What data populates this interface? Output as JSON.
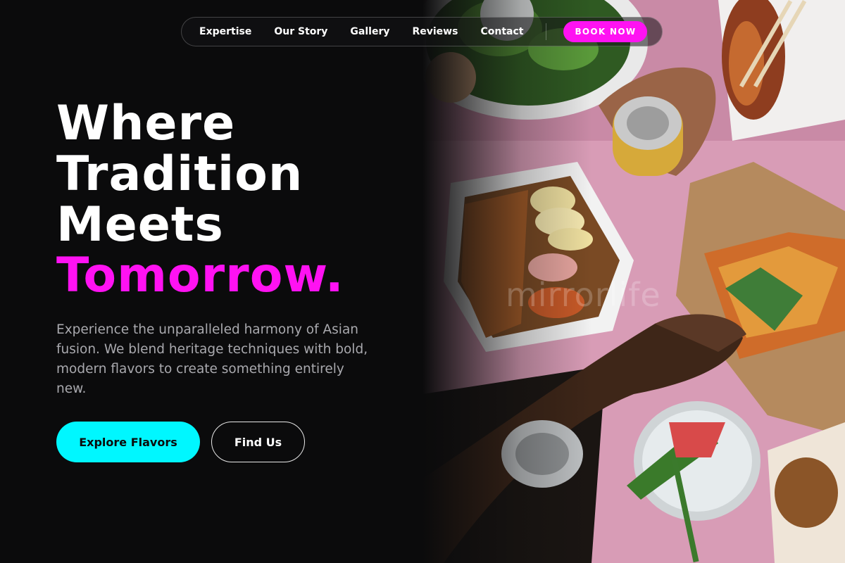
{
  "nav": {
    "links": [
      "Expertise",
      "Our Story",
      "Gallery",
      "Reviews",
      "Contact"
    ],
    "cta": "BOOK NOW"
  },
  "hero": {
    "headline": [
      "Where",
      "Tradition",
      "Meets"
    ],
    "headline_accent": "Tomorrow.",
    "description": "Experience the unparalleled harmony of Asian fusion. We blend heritage techniques with bold, modern flavors to create something entirely new.",
    "primary_button": "Explore Flavors",
    "secondary_button": "Find Us",
    "image_watermark": "mirrorlife"
  },
  "colors": {
    "background": "#0b0b0c",
    "accent_magenta": "#ff12f2",
    "accent_cyan": "#00f7ff",
    "muted_text": "#a9a9ae"
  },
  "icons": {
    "hero_image": "food-spread-photo"
  }
}
